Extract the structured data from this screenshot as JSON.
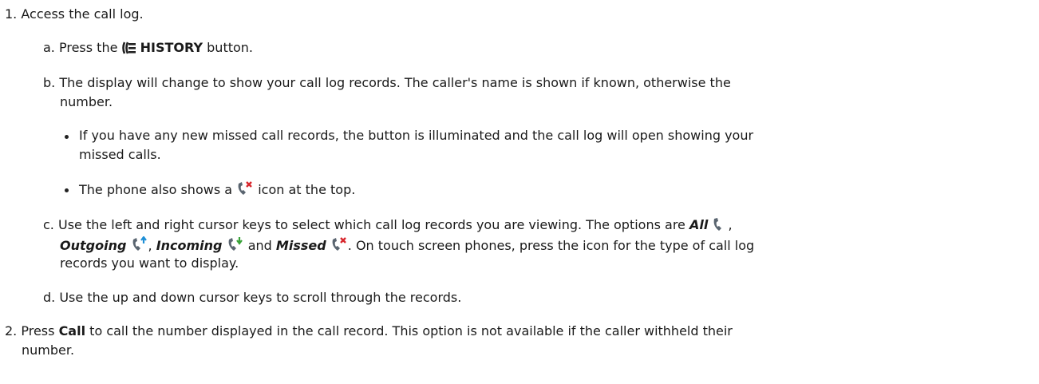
{
  "steps": [
    {
      "num": "1.",
      "text": "Access the call log.",
      "substeps": [
        {
          "letter": "a.",
          "pre": "Press the",
          "button_label": "HISTORY",
          "post": "button."
        },
        {
          "letter": "b.",
          "line1": "The display will change to show your call log records. The caller's name is shown if known, otherwise the",
          "line2": "number.",
          "bullets": [
            {
              "line1": "If you have any new missed call records, the button is illuminated and the call log will open showing your",
              "line2": "missed calls."
            },
            {
              "pre": "The phone also shows a",
              "post": "icon at the top."
            }
          ]
        },
        {
          "letter": "c.",
          "line1_pre": "Use the left and right cursor keys to select which call log records you are viewing. The options are",
          "opt_all": "All",
          "opt_outgoing": "Outgoing",
          "opt_incoming": "Incoming",
          "and": "and",
          "opt_missed": "Missed",
          "line2_post": ". On touch screen phones, press the icon for the type of call log",
          "line3": "records you want to display."
        },
        {
          "letter": "d.",
          "text": "Use the up and down cursor keys to scroll through the records."
        }
      ]
    },
    {
      "num": "2.",
      "pre": "Press",
      "bold": "Call",
      "line1_post": "to call the number displayed in the call record. This option is not available if the caller withheld their",
      "line2": "number."
    }
  ],
  "colors": {
    "text": "#1a1a1a",
    "icon_handset": "#5a6570",
    "icon_missed_x": "#d8262c",
    "icon_outgoing_arrow": "#1e8fd6",
    "icon_incoming_arrow": "#3aa33a"
  },
  "icons": [
    "history-icon",
    "missed-call-icon",
    "all-calls-icon",
    "outgoing-call-icon",
    "incoming-call-icon"
  ]
}
